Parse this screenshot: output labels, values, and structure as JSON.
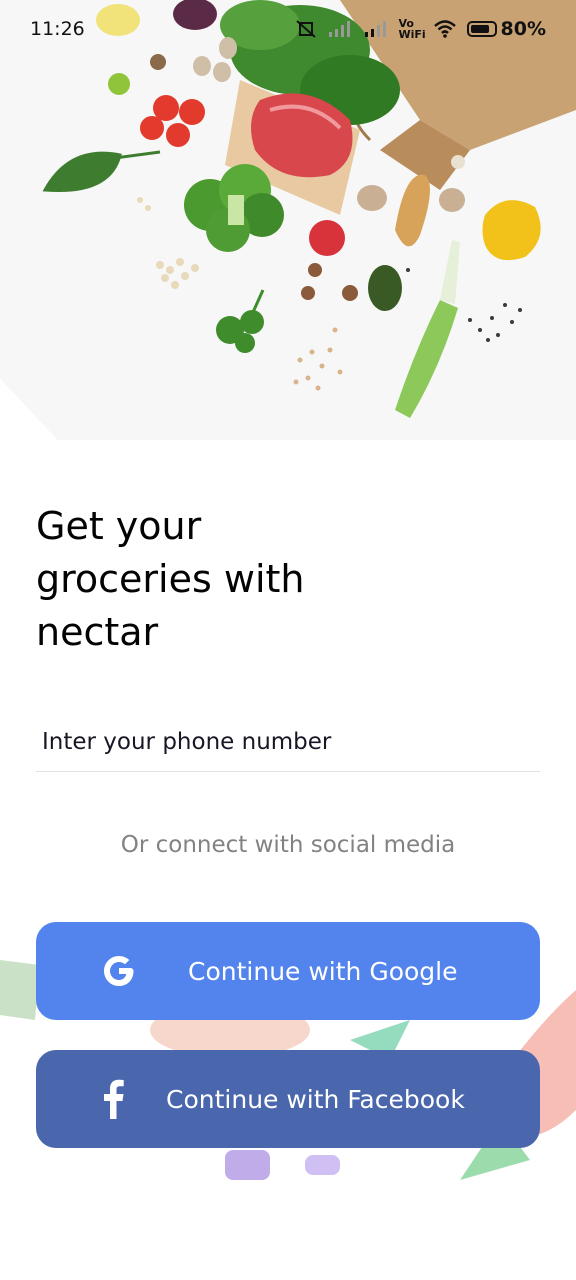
{
  "status_bar": {
    "time": "11:26",
    "network_label": "Vo WiFi",
    "battery_percent": "80%",
    "icons": [
      "mute-vibrate-icon",
      "signal-icon",
      "signal-icon",
      "wifi-icon",
      "battery-icon"
    ]
  },
  "hero": {
    "image": "groceries-flatlay-illustration"
  },
  "main": {
    "title": "Get your groceries with nectar",
    "phone_input": {
      "placeholder": "Inter your phone number",
      "value": ""
    },
    "social_prompt": "Or connect with social media",
    "google_button": {
      "label": "Continue with Google",
      "icon": "google-icon"
    },
    "facebook_button": {
      "label": "Continue with Facebook",
      "icon": "facebook-icon"
    }
  },
  "colors": {
    "google": "#5383ec",
    "facebook": "#4a66ac",
    "muted_text": "#828282"
  }
}
